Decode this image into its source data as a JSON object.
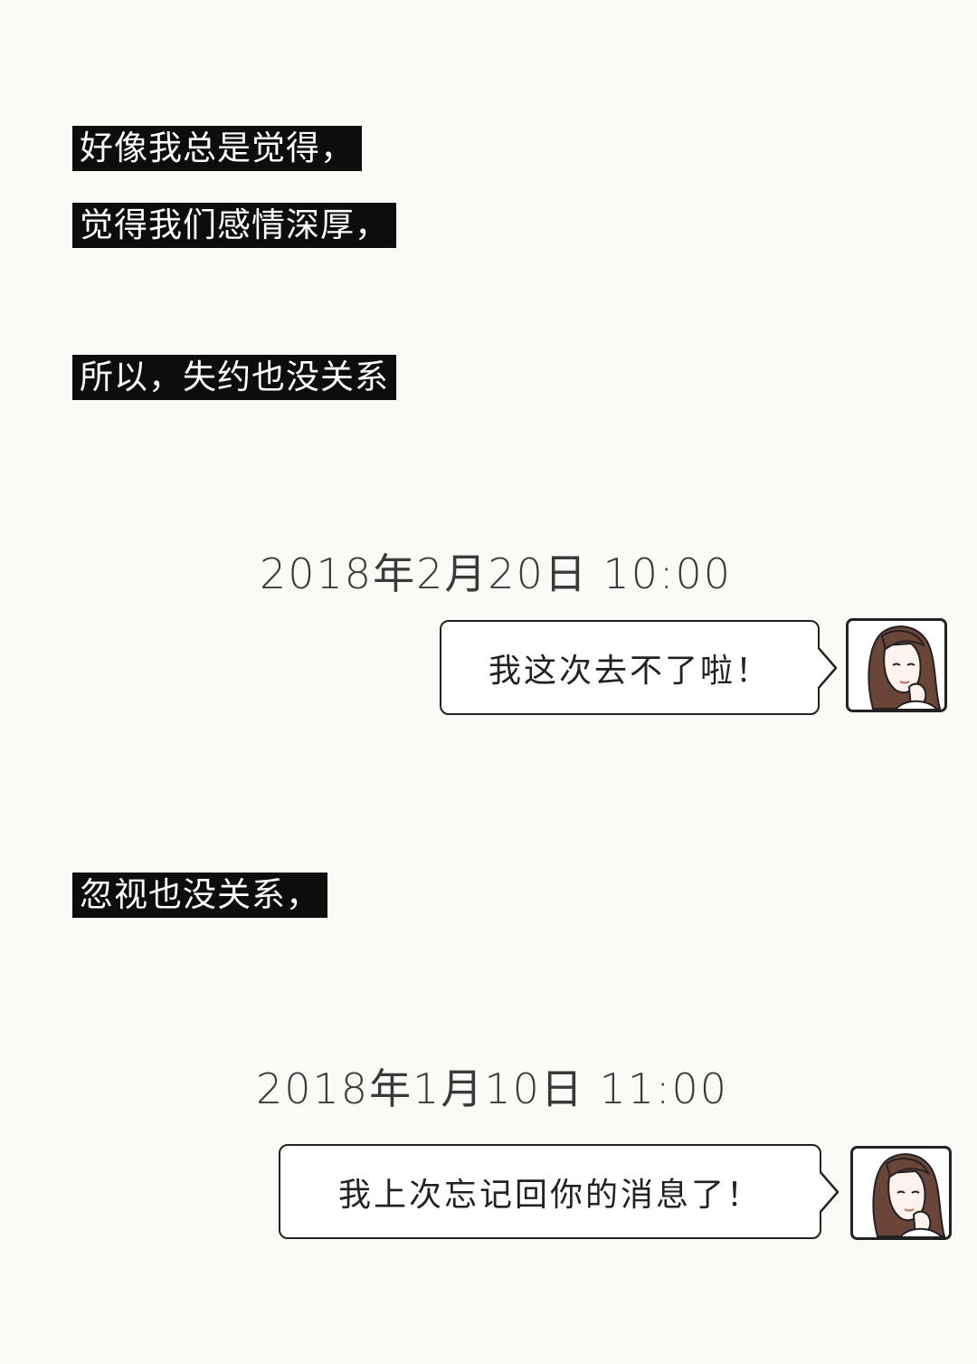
{
  "captions": [
    "好像我总是觉得，",
    "觉得我们感情深厚，",
    "所以，失约也没关系",
    "忽视也没关系，"
  ],
  "messages": [
    {
      "timestamp": "2018年2月20日 10:00",
      "text": "我这次去不了啦！",
      "avatar_icon": "girl-avatar-icon"
    },
    {
      "timestamp": "2018年1月10日 11:00",
      "text": "我上次忘记回你的消息了！",
      "avatar_icon": "girl-avatar-icon"
    }
  ],
  "colors": {
    "background": "#fcfaf6",
    "caption_bg": "#0d0d0d",
    "caption_text": "#ffffff",
    "hair": "#6b4538",
    "outline": "#222222"
  }
}
